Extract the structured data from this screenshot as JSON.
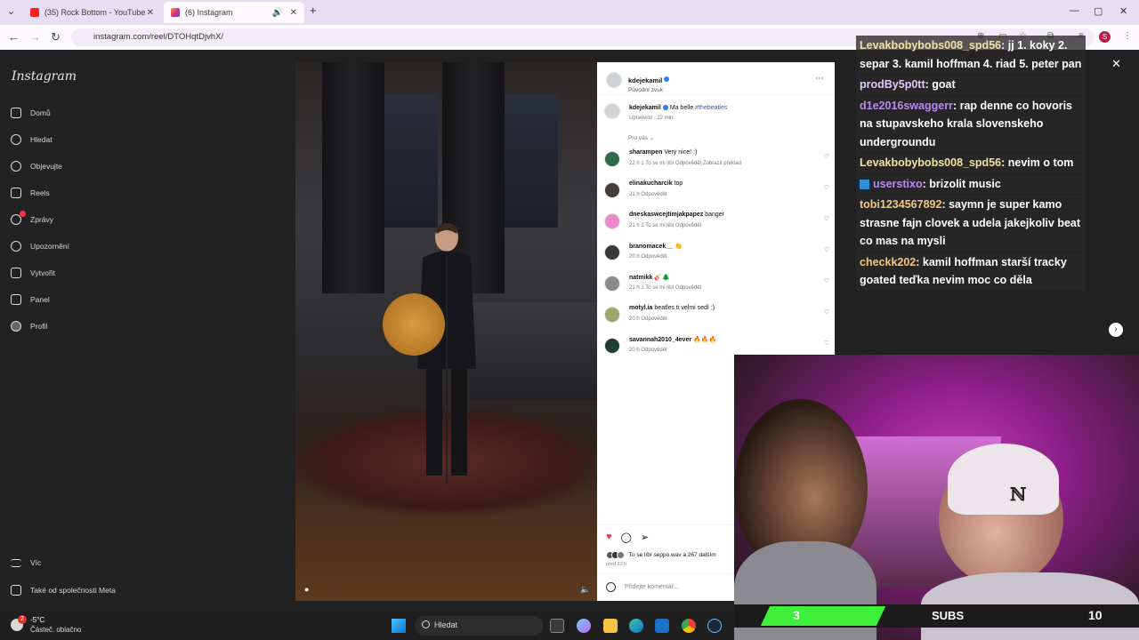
{
  "browser": {
    "tabs": [
      {
        "title": "(35) Rock Bottom - YouTube",
        "active": false
      },
      {
        "title": "(6) Instagram",
        "active": true
      }
    ],
    "url": "instagram.com/reel/DTOHqtDjvhX/",
    "profile_initial": "S"
  },
  "instagram": {
    "logo": "Instagram",
    "nav": [
      {
        "label": "Domů",
        "icon": "home-icon"
      },
      {
        "label": "Hledat",
        "icon": "search-icon"
      },
      {
        "label": "Objevujte",
        "icon": "compass-icon"
      },
      {
        "label": "Reels",
        "icon": "reels-icon"
      },
      {
        "label": "Zprávy",
        "icon": "messages-icon"
      },
      {
        "label": "Upozornění",
        "icon": "heart-icon"
      },
      {
        "label": "Vytvořit",
        "icon": "plus-icon"
      },
      {
        "label": "Panel",
        "icon": "dashboard-icon"
      },
      {
        "label": "Profil",
        "icon": "profile-icon"
      }
    ],
    "more_label": "Víc",
    "meta_label": "Také od společnosti Meta",
    "post": {
      "author": "kdejekamil",
      "audio": "Původní zvuk",
      "caption_text": "Ma belle ",
      "caption_tag": "#thebeatles",
      "caption_meta": "Upraveno · 22 min.",
      "filter_label": "Pro vás"
    },
    "comments": [
      {
        "user": "sharampen",
        "text": "Very nice! :)",
        "meta": "22 h    1 To se mi líbí    Odpovědět    Zobrazit překlad"
      },
      {
        "user": "elinakucharcik",
        "text": "top",
        "meta": "21 h    Odpovědět"
      },
      {
        "user": "dneskaswcejtimjakpapez",
        "text": "banger",
        "meta": "21 h    1 To se mi líbí    Odpovědět"
      },
      {
        "user": "branomacek__",
        "text": "👏",
        "meta": "20 h    Odpovědět"
      },
      {
        "user": "natmikk",
        "text": "🎸🌲",
        "meta": "21 h    1 To se mi líbí    Odpovědět"
      },
      {
        "user": "motyl.ia",
        "text": "beatles ti velmi sedí :)",
        "meta": "20 h    Odpovědět"
      },
      {
        "user": "savannah2010_4ever",
        "text": "🔥🔥🔥",
        "meta": "20 h    Odpovědět"
      }
    ],
    "likes": "To se líbí seppo.wav a 267 dalším",
    "posted_ago": "před 22 h",
    "add_comment_placeholder": "Přidejte komentář..."
  },
  "stream_chat": [
    {
      "user": "Levakbobybobs008_spd56",
      "user_color": "#f2e2a6",
      "text": ": jj 1. koky 2. separ 3. kamil hoffman 4. riad 5. peter pan"
    },
    {
      "user": "prodBy5p0tt",
      "user_color": "#e3c9f2",
      "text": ": goat"
    },
    {
      "user": "d1e2016swaggerr",
      "user_color": "#b88cf0",
      "text": ": rap denne co hovoris na stupavskeho krala slovenskeho undergroundu"
    },
    {
      "user": "Levakbobybobs008_spd56",
      "user_color": "#f2e2a6",
      "text": ": nevim o tom"
    },
    {
      "user": "userstixo",
      "user_color": "#b88cf0",
      "text": ": brizolit music"
    },
    {
      "user": "tobi1234567892",
      "user_color": "#f4c882",
      "text": ": saymn je super kamo strasne fajn clovek a udela jakejkoliv beat co mas na mysli"
    },
    {
      "user": "checkk202",
      "user_color": "#f4c882",
      "text": ": kamil hoffman starší tracky goated teďka nevim moc co děla"
    }
  ],
  "sub_counter": {
    "left": "3",
    "label": "SUBS",
    "right": "10"
  },
  "taskbar": {
    "weather_temp": "-5°C",
    "weather_cond": "Částeč. oblačno",
    "weather_badge": "2",
    "search_label": "Hledat"
  }
}
